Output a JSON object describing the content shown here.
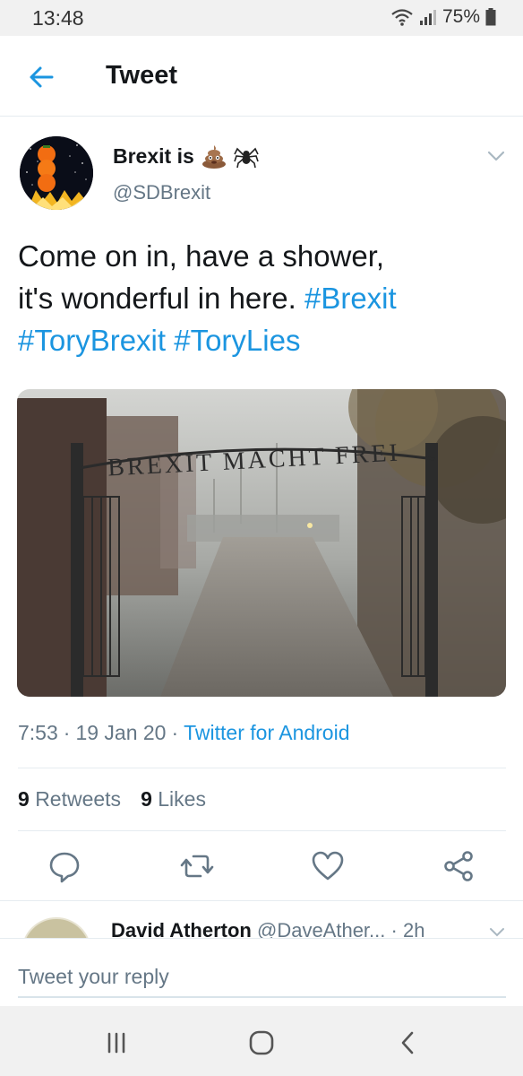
{
  "status_bar": {
    "time": "13:48",
    "battery": "75%"
  },
  "header": {
    "title": "Tweet"
  },
  "tweet": {
    "author_name": "Brexit is",
    "author_emojis": [
      "pile-of-poo-emoji",
      "spider-emoji"
    ],
    "handle": "@SDBrexit",
    "text_lines": [
      {
        "plain": "Come on in, have a shower,",
        "tag": ""
      },
      {
        "plain": "it's wonderful in here. ",
        "tag": "#Brexit"
      },
      {
        "plain": "",
        "tag": "#ToryBrexit #ToryLies"
      }
    ],
    "image_sign_text": "BREXIT MACHT FREI",
    "time": "7:53",
    "date": "19 Jan 20",
    "source": "Twitter for Android",
    "retweets_count": "9",
    "retweets_label": "Retweets",
    "likes_count": "9",
    "likes_label": "Likes"
  },
  "actions": [
    "reply-icon",
    "retweet-icon",
    "like-icon",
    "share-icon"
  ],
  "reply_preview": {
    "name": "David Atherton",
    "handle": "@DaveAther...",
    "time": "· 2h"
  },
  "compose": {
    "placeholder": "Tweet your reply"
  },
  "nav_bar": [
    "recent-apps-icon",
    "home-icon",
    "back-icon"
  ],
  "colors": {
    "accent": "#1b95e0",
    "text": "#14171a",
    "secondary": "#657786"
  }
}
